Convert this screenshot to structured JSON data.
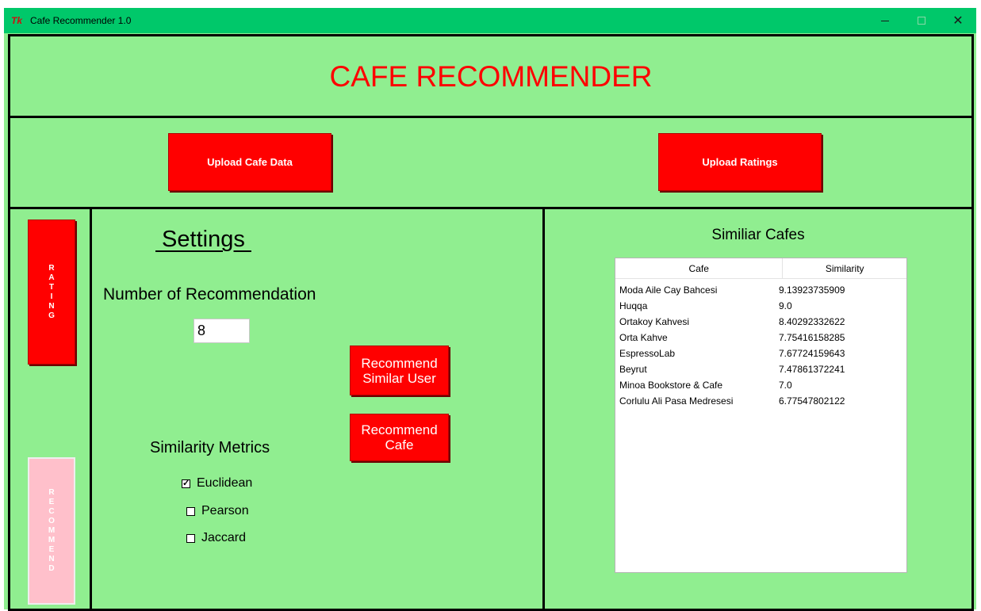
{
  "window": {
    "title": "Cafe Recommender 1.0",
    "icon": "Tk",
    "close_glyph": "✕"
  },
  "header": {
    "title": "CAFE RECOMMENDER"
  },
  "uploads": {
    "cafe_data_label": "Upload Cafe Data",
    "ratings_label": "Upload Ratings"
  },
  "rail": {
    "rating_letters": [
      "R",
      "A",
      "T",
      "I",
      "N",
      "G"
    ],
    "recommend_letters": [
      "R",
      "E",
      "C",
      "O",
      "M",
      "M",
      "E",
      "N",
      "D"
    ]
  },
  "settings": {
    "title": " Settings ",
    "num_label": "Number of Recommendation",
    "num_value": "8",
    "recommend_user_label_1": "Recommend",
    "recommend_user_label_2": "Similar User",
    "recommend_cafe_label_1": "Recommend",
    "recommend_cafe_label_2": "Cafe",
    "metrics_label": "Similarity Metrics",
    "metrics": [
      {
        "label": "Euclidean",
        "checked": true
      },
      {
        "label": "Pearson",
        "checked": false
      },
      {
        "label": "Jaccard",
        "checked": false
      }
    ]
  },
  "results": {
    "title": "Similiar Cafes",
    "columns": [
      "Cafe",
      "Similarity"
    ],
    "rows": [
      [
        "Moda Aile Cay Bahcesi",
        "9.13923735909"
      ],
      [
        "Huqqa",
        "9.0"
      ],
      [
        "Ortakoy Kahvesi",
        "8.40292332622"
      ],
      [
        "Orta Kahve",
        "7.75416158285"
      ],
      [
        "EspressoLab",
        "7.67724159643"
      ],
      [
        "Beyrut",
        "7.47861372241"
      ],
      [
        "Minoa Bookstore & Cafe",
        "7.0"
      ],
      [
        "Corlulu Ali Pasa Medresesi",
        "6.77547802122"
      ]
    ]
  },
  "colors": {
    "background": "#90ee90",
    "titlebar": "#00c86a",
    "button": "#ff0000",
    "disabled_button": "#ffc0cb",
    "heading": "#ff0000"
  }
}
